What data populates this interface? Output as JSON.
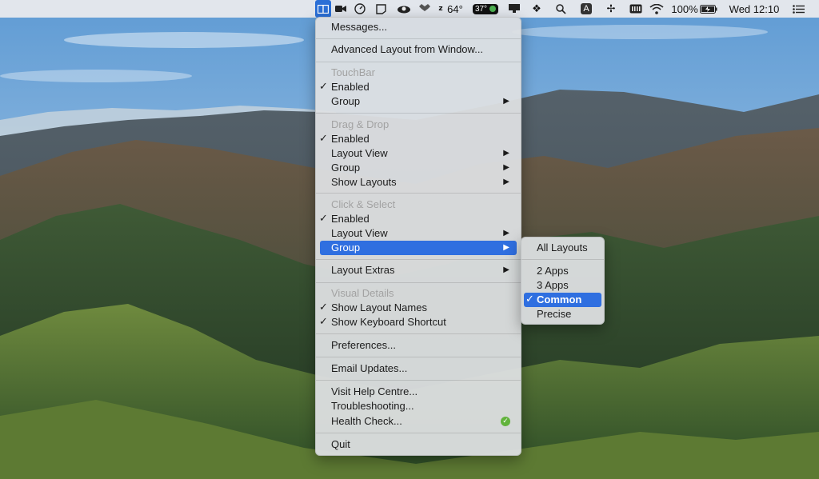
{
  "menubar": {
    "temperature": "64°",
    "battery_chip": "37°",
    "input_letter": "A",
    "battery_percent": "100%",
    "clock": "Wed 12:10"
  },
  "main_menu": {
    "messages": "Messages...",
    "advanced_layout": "Advanced Layout from Window...",
    "touchbar_header": "TouchBar",
    "touchbar_enabled": "Enabled",
    "touchbar_group": "Group",
    "dragdrop_header": "Drag & Drop",
    "dragdrop_enabled": "Enabled",
    "dragdrop_layout_view": "Layout View",
    "dragdrop_group": "Group",
    "dragdrop_show_layouts": "Show Layouts",
    "click_header": "Click & Select",
    "click_enabled": "Enabled",
    "click_layout_view": "Layout View",
    "click_group": "Group",
    "layout_extras": "Layout Extras",
    "visual_header": "Visual Details",
    "show_layout_names": "Show Layout Names",
    "show_keyboard_shortcut": "Show Keyboard Shortcut",
    "preferences": "Preferences...",
    "email_updates": "Email Updates...",
    "visit_help": "Visit Help Centre...",
    "troubleshooting": "Troubleshooting...",
    "health_check": "Health Check...",
    "quit": "Quit"
  },
  "submenu": {
    "all_layouts": "All Layouts",
    "two_apps": "2 Apps",
    "three_apps": "3 Apps",
    "common": "Common",
    "precise": "Precise"
  },
  "colors": {
    "selection": "#2f6fe0",
    "health_ok": "#61b33b"
  }
}
